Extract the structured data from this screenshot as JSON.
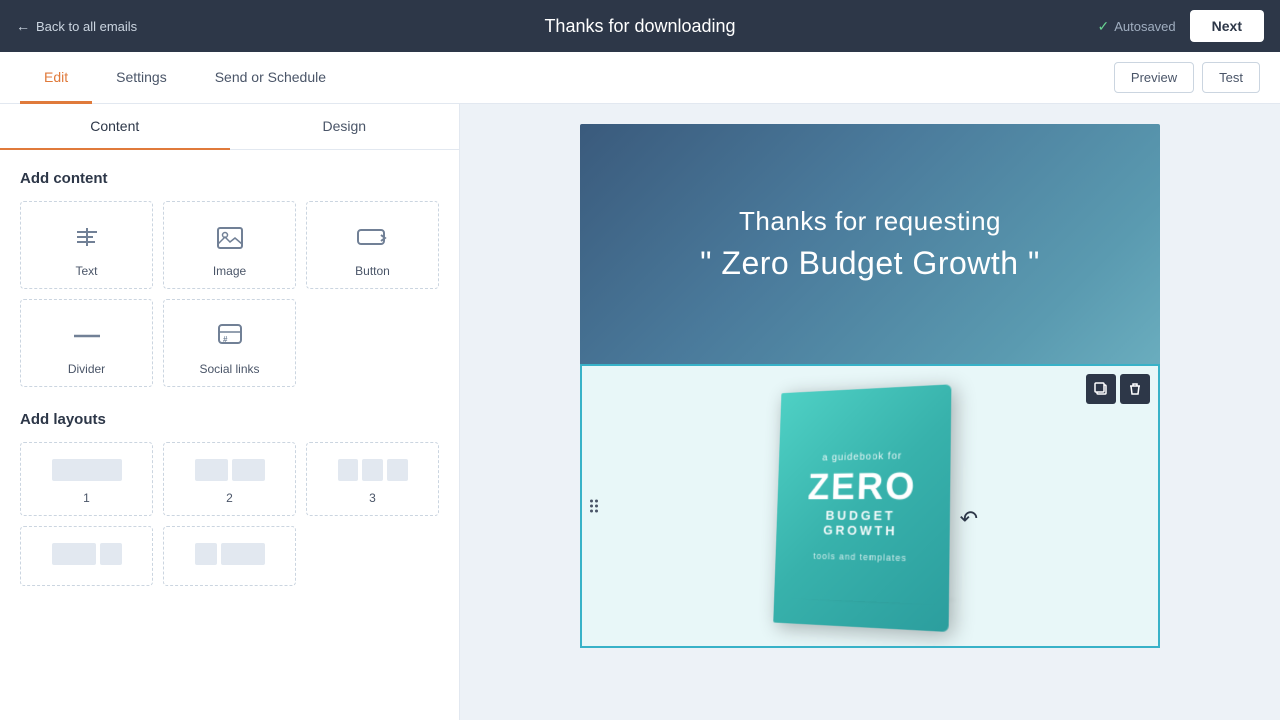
{
  "topNav": {
    "backLabel": "Back to all emails",
    "title": "Thanks for downloading",
    "autosaved": "Autosaved",
    "nextLabel": "Next"
  },
  "secNav": {
    "tabs": [
      {
        "id": "edit",
        "label": "Edit",
        "active": true
      },
      {
        "id": "settings",
        "label": "Settings",
        "active": false
      },
      {
        "id": "send-schedule",
        "label": "Send or Schedule",
        "active": false
      }
    ],
    "previewLabel": "Preview",
    "testLabel": "Test"
  },
  "sidebar": {
    "tabs": [
      {
        "id": "content",
        "label": "Content",
        "active": true
      },
      {
        "id": "design",
        "label": "Design",
        "active": false
      }
    ],
    "addContentTitle": "Add content",
    "contentItems": [
      {
        "id": "text",
        "label": "Text",
        "icon": "text-icon"
      },
      {
        "id": "image",
        "label": "Image",
        "icon": "image-icon"
      },
      {
        "id": "button",
        "label": "Button",
        "icon": "button-icon"
      },
      {
        "id": "divider",
        "label": "Divider",
        "icon": "divider-icon"
      },
      {
        "id": "social-links",
        "label": "Social links",
        "icon": "social-icon"
      }
    ],
    "addLayoutsTitle": "Add layouts",
    "layoutItems": [
      {
        "id": "layout-1",
        "label": "1",
        "cols": 1
      },
      {
        "id": "layout-2",
        "label": "2",
        "cols": 2
      },
      {
        "id": "layout-3",
        "label": "3",
        "cols": 3
      }
    ]
  },
  "emailCanvas": {
    "headerLine1": "Thanks for requesting",
    "headerLine2": "\" Zero Budget Growth \"",
    "bookSmallLabel": "a guidebook for",
    "bookZero": "ZERO",
    "bookBudget": "BUDGET GROWTH",
    "bookTools": "tools and templates"
  },
  "toolbar": {
    "copyTitle": "Copy",
    "deleteTitle": "Delete"
  }
}
